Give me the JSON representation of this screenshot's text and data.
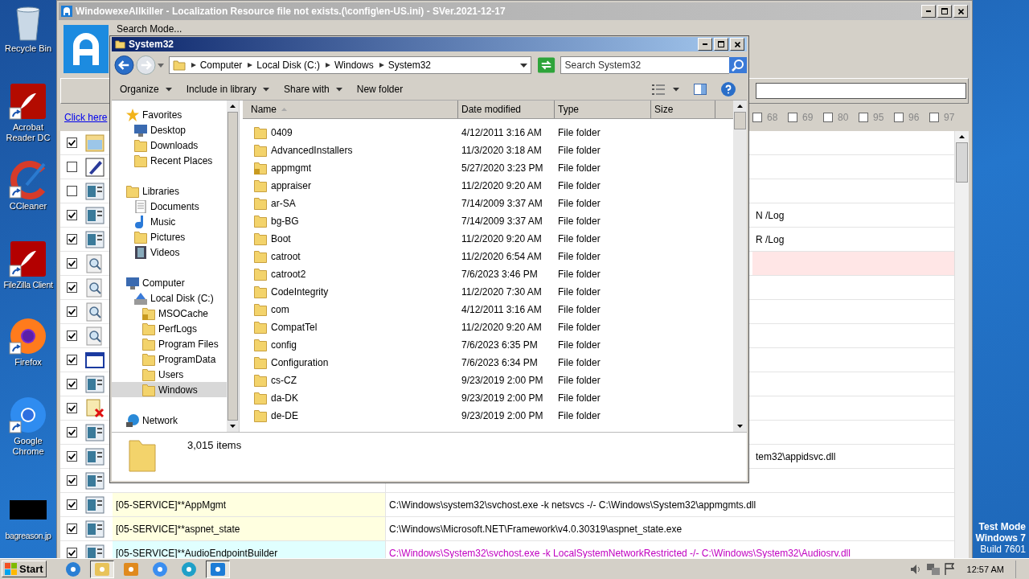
{
  "desktop_icons": [
    {
      "label": "Recycle Bin",
      "kind": "recycle",
      "shortcut": false
    },
    {
      "label": "Acrobat Reader DC",
      "kind": "acrobat",
      "shortcut": true
    },
    {
      "label": "CCleaner",
      "kind": "ccleaner",
      "shortcut": true
    },
    {
      "label": "FileZilla Client",
      "kind": "filezilla",
      "shortcut": true
    },
    {
      "label": "Firefox",
      "kind": "firefox",
      "shortcut": true
    },
    {
      "label": "Google Chrome",
      "kind": "chrome",
      "shortcut": true
    },
    {
      "label": "bagreason.jp",
      "kind": "image",
      "shortcut": false
    }
  ],
  "back_window": {
    "title": "WindowexeAllkiller - Localization Resource file not exists.(\\config\\en-US.ini) - SVer.2021-12-17",
    "menu": "Search Mode...",
    "link": "Click here",
    "filters": [
      {
        "label": "68",
        "checked": false
      },
      {
        "label": "69",
        "checked": false
      },
      {
        "label": "80",
        "checked": false
      },
      {
        "label": "95",
        "checked": false
      },
      {
        "label": "96",
        "checked": false
      },
      {
        "label": "97",
        "checked": false
      }
    ],
    "rows": [
      {
        "checked": true,
        "kind": "app"
      },
      {
        "checked": false,
        "kind": "pencil"
      },
      {
        "checked": false,
        "kind": "service"
      },
      {
        "checked": true,
        "kind": "service",
        "command": "N /Log",
        "covered": true
      },
      {
        "checked": true,
        "kind": "service",
        "command": "R /Log",
        "covered": true
      },
      {
        "checked": true,
        "kind": "magnifier",
        "color": "#ffe6e6",
        "covered": true
      },
      {
        "checked": true,
        "kind": "magnifier"
      },
      {
        "checked": true,
        "kind": "magnifier"
      },
      {
        "checked": true,
        "kind": "magnifier"
      },
      {
        "checked": true,
        "kind": "window"
      },
      {
        "checked": true,
        "kind": "service"
      },
      {
        "checked": true,
        "kind": "blocked"
      },
      {
        "checked": true,
        "kind": "service"
      },
      {
        "checked": true,
        "kind": "service",
        "command": "tem32\\appidsvc.dll",
        "covered": true
      },
      {
        "checked": true,
        "kind": "service"
      },
      {
        "checked": true,
        "kind": "service",
        "name": "[05-SERVICE]**AppMgmt",
        "color": "#ffffe0",
        "command": "C:\\Windows\\system32\\svchost.exe -k netsvcs -/- C:\\Windows\\System32\\appmgmts.dll",
        "covered": false,
        "flagged": false
      },
      {
        "checked": true,
        "kind": "service",
        "name": "[05-SERVICE]**aspnet_state",
        "color": "#ffffe0",
        "command": "C:\\Windows\\Microsoft.NET\\Framework\\v4.0.30319\\aspnet_state.exe",
        "covered": false,
        "flagged": false
      },
      {
        "checked": true,
        "kind": "service",
        "name": "[05-SERVICE]**AudioEndpointBuilder",
        "color": "#e0ffff",
        "command": "C:\\Windows\\System32\\svchost.exe -k LocalSystemNetworkRestricted -/- C:\\Windows\\System32\\Audiosrv.dll",
        "covered": false,
        "flagged": true
      }
    ]
  },
  "explorer": {
    "title": "System32",
    "breadcrumb": [
      "Computer",
      "Local Disk (C:)",
      "Windows",
      "System32"
    ],
    "search": {
      "placeholder": "Search System32"
    },
    "toolbar": [
      {
        "label": "Organize",
        "dropdown": true
      },
      {
        "label": "Include in library",
        "dropdown": true
      },
      {
        "label": "Share with",
        "dropdown": true
      },
      {
        "label": "New folder",
        "dropdown": false
      }
    ],
    "nav": [
      {
        "label": "Favorites",
        "kind": "star",
        "selected": false,
        "children": [
          {
            "label": "Desktop",
            "kind": "monitor",
            "selected": false
          },
          {
            "label": "Downloads",
            "kind": "folder",
            "selected": false
          },
          {
            "label": "Recent Places",
            "kind": "folder",
            "selected": false
          }
        ]
      },
      {
        "label": "Libraries",
        "kind": "folder",
        "selected": false,
        "children": [
          {
            "label": "Documents",
            "kind": "document",
            "selected": false
          },
          {
            "label": "Music",
            "kind": "music",
            "selected": false
          },
          {
            "label": "Pictures",
            "kind": "folder",
            "selected": false
          },
          {
            "label": "Videos",
            "kind": "film",
            "selected": false
          }
        ]
      },
      {
        "label": "Computer",
        "kind": "monitor",
        "selected": false,
        "children": [
          {
            "label": "Local Disk (C:)",
            "kind": "drive",
            "selected": false,
            "children": [
              {
                "label": "MSOCache",
                "kind": "locked",
                "selected": false
              },
              {
                "label": "PerfLogs",
                "kind": "folder",
                "selected": false
              },
              {
                "label": "Program Files",
                "kind": "folder",
                "selected": false
              },
              {
                "label": "ProgramData",
                "kind": "folder",
                "selected": false
              },
              {
                "label": "Users",
                "kind": "folder",
                "selected": false
              },
              {
                "label": "Windows",
                "kind": "folder",
                "selected": true
              }
            ]
          }
        ]
      },
      {
        "label": "Network",
        "kind": "network",
        "selected": false
      }
    ],
    "columns": [
      "Name",
      "Date modified",
      "Type",
      "Size"
    ],
    "files": [
      {
        "name": "0409",
        "date": "4/12/2011 3:16 AM",
        "type": "File folder",
        "locked": false
      },
      {
        "name": "AdvancedInstallers",
        "date": "11/3/2020 3:18 AM",
        "type": "File folder",
        "locked": false
      },
      {
        "name": "appmgmt",
        "date": "5/27/2020 3:23 PM",
        "type": "File folder",
        "locked": true
      },
      {
        "name": "appraiser",
        "date": "11/2/2020 9:20 AM",
        "type": "File folder",
        "locked": false
      },
      {
        "name": "ar-SA",
        "date": "7/14/2009 3:37 AM",
        "type": "File folder",
        "locked": false
      },
      {
        "name": "bg-BG",
        "date": "7/14/2009 3:37 AM",
        "type": "File folder",
        "locked": false
      },
      {
        "name": "Boot",
        "date": "11/2/2020 9:20 AM",
        "type": "File folder",
        "locked": false
      },
      {
        "name": "catroot",
        "date": "11/2/2020 6:54 AM",
        "type": "File folder",
        "locked": false
      },
      {
        "name": "catroot2",
        "date": "7/6/2023 3:46 PM",
        "type": "File folder",
        "locked": false
      },
      {
        "name": "CodeIntegrity",
        "date": "11/2/2020 7:30 AM",
        "type": "File folder",
        "locked": false
      },
      {
        "name": "com",
        "date": "4/12/2011 3:16 AM",
        "type": "File folder",
        "locked": false
      },
      {
        "name": "CompatTel",
        "date": "11/2/2020 9:20 AM",
        "type": "File folder",
        "locked": false
      },
      {
        "name": "config",
        "date": "7/6/2023 6:35 PM",
        "type": "File folder",
        "locked": false
      },
      {
        "name": "Configuration",
        "date": "7/6/2023 6:34 PM",
        "type": "File folder",
        "locked": false
      },
      {
        "name": "cs-CZ",
        "date": "9/23/2019 2:00 PM",
        "type": "File folder",
        "locked": false
      },
      {
        "name": "da-DK",
        "date": "9/23/2019 2:00 PM",
        "type": "File folder",
        "locked": false
      },
      {
        "name": "de-DE",
        "date": "9/23/2019 2:00 PM",
        "type": "File folder",
        "locked": false
      }
    ],
    "status": "3,015 items"
  },
  "os_notice": [
    "Test Mode",
    "Windows 7",
    "Build 7601"
  ],
  "taskbar": {
    "start": "Start",
    "apps": [
      {
        "kind": "ie",
        "selected": false
      },
      {
        "kind": "explorer",
        "selected": true
      },
      {
        "kind": "media",
        "selected": false
      },
      {
        "kind": "chrome",
        "selected": false
      },
      {
        "kind": "edge",
        "selected": false
      },
      {
        "kind": "allkiller",
        "selected": true
      }
    ],
    "clock": "12:57 AM"
  }
}
